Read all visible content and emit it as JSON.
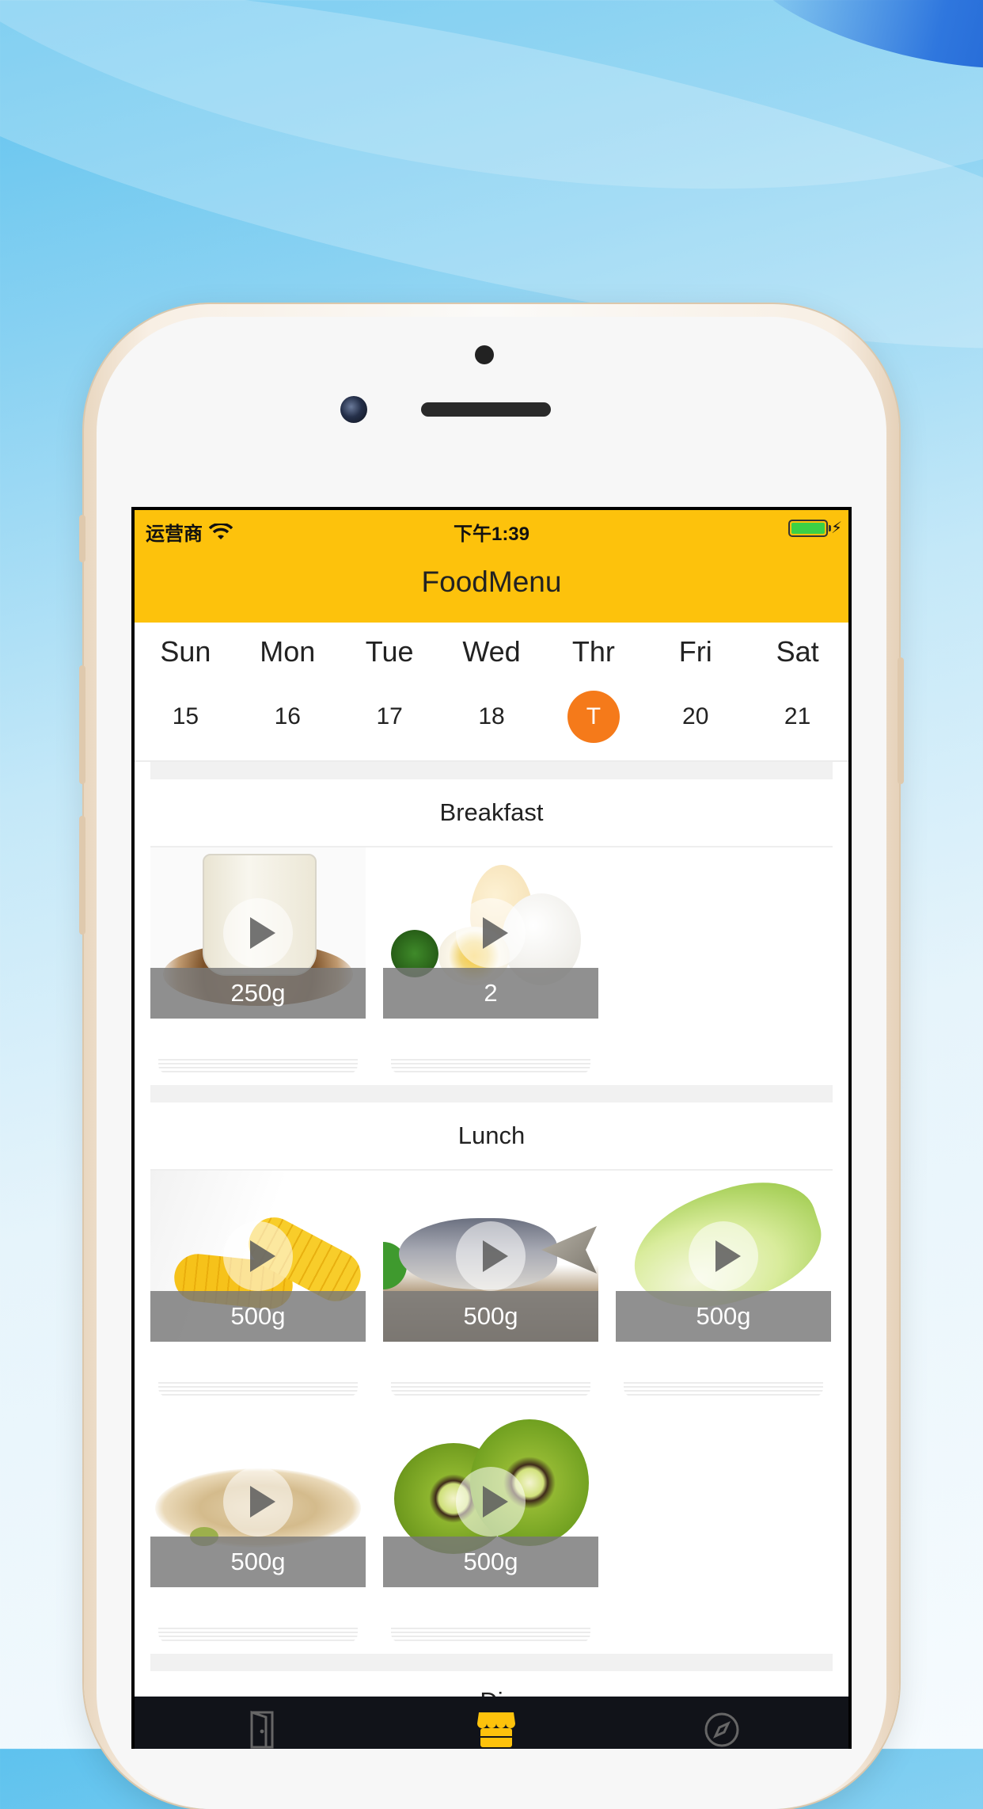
{
  "status_bar": {
    "carrier": "运营商",
    "time": "下午1:39"
  },
  "app": {
    "title": "FoodMenu"
  },
  "week": {
    "days": [
      "Sun",
      "Mon",
      "Tue",
      "Wed",
      "Thr",
      "Fri",
      "Sat"
    ],
    "dates": [
      "15",
      "16",
      "17",
      "18",
      "T",
      "20",
      "21"
    ],
    "selected_index": 4
  },
  "sections": {
    "breakfast": {
      "title": "Breakfast",
      "items": [
        {
          "food": "soy-milk",
          "amount": "250g"
        },
        {
          "food": "eggs",
          "amount": "2"
        }
      ]
    },
    "lunch": {
      "title": "Lunch",
      "items": [
        {
          "food": "corn",
          "amount": "500g"
        },
        {
          "food": "fish",
          "amount": "500g"
        },
        {
          "food": "cabbage",
          "amount": "500g"
        },
        {
          "food": "pistachios",
          "amount": "500g"
        },
        {
          "food": "kiwi",
          "amount": "500g"
        }
      ]
    },
    "dinner": {
      "title": "Di"
    }
  },
  "tabbar": {
    "tabs": [
      {
        "icon": "door-icon"
      },
      {
        "icon": "shop-icon"
      },
      {
        "icon": "compass-icon"
      }
    ]
  },
  "colors": {
    "header": "#fdc20c",
    "today": "#f57a1a",
    "tabbar": "#111319",
    "active_tab": "#fdc20c"
  }
}
